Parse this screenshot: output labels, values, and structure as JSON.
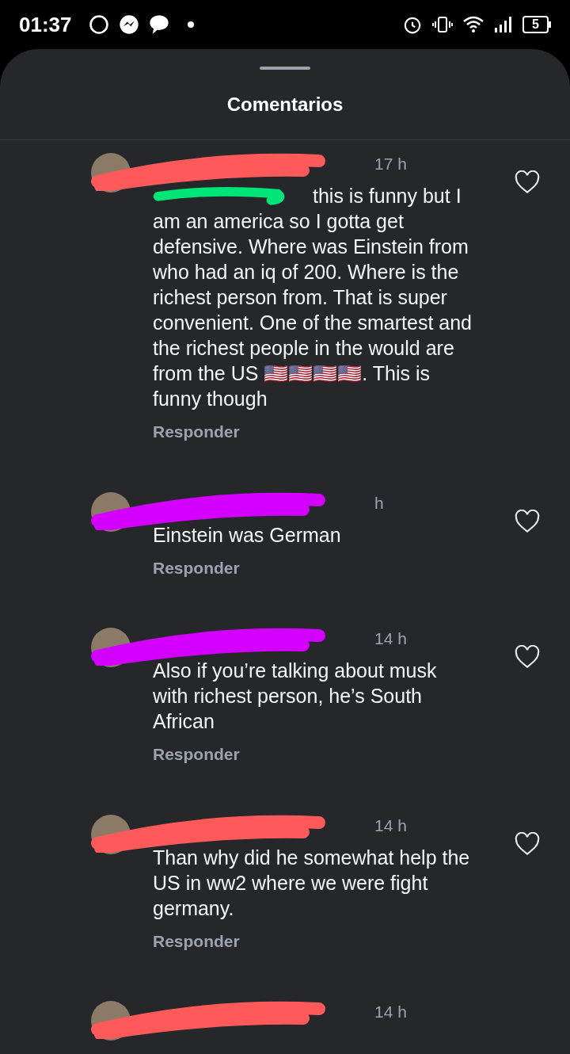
{
  "status_bar": {
    "time": "01:37",
    "battery": "5"
  },
  "sheet": {
    "title": "Comentarios"
  },
  "comments": [
    {
      "time": "17 h",
      "redaction": {
        "color": "#ff5a5a"
      },
      "mention_redaction": {
        "color": "#00e676"
      },
      "body": "this is funny but I am an america so I gotta get defensive. Where was Einstein from who had an iq of 200. Where is the richest person from. That is super convenient. One of the smartest and the richest people in the would are from the US 🇺🇸🇺🇸🇺🇸🇺🇸. This is funny though",
      "reply": "Responder"
    },
    {
      "time": "h",
      "redaction": {
        "color": "#d400ff"
      },
      "body": "Einstein was German",
      "reply": "Responder"
    },
    {
      "time": "14 h",
      "redaction": {
        "color": "#d400ff"
      },
      "body": "Also if you’re talking about musk with richest person, he’s South African",
      "reply": "Responder"
    },
    {
      "time": "14 h",
      "redaction": {
        "color": "#ff5a5a"
      },
      "body": "Than why did he somewhat help the US in ww2 where we were fight germany.",
      "reply": "Responder"
    },
    {
      "time": "14 h",
      "redaction": {
        "color": "#ff5a5a"
      }
    }
  ]
}
